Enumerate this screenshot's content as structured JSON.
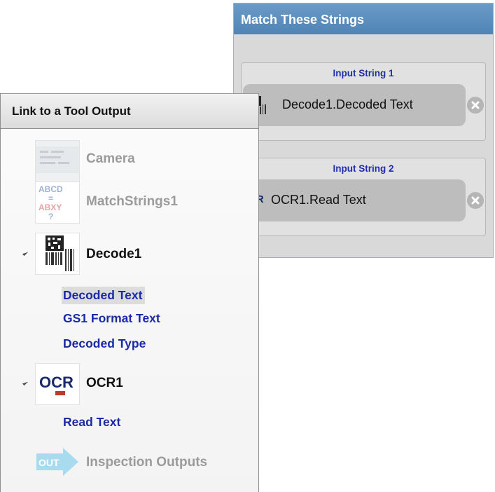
{
  "match_panel": {
    "title": "Match These Strings",
    "inputs": [
      {
        "label": "Input String 1",
        "value": "Decode1.Decoded Text",
        "icon": "barcode-icon"
      },
      {
        "label": "Input String 2",
        "value": "OCR1.Read Text",
        "icon": "ocr-icon"
      }
    ]
  },
  "link_panel": {
    "title": "Link to a Tool Output",
    "tools": [
      {
        "label": "Camera",
        "icon": "camera-image-icon",
        "enabled": false
      },
      {
        "label": "MatchStrings1",
        "icon": "match-strings-icon",
        "enabled": false
      },
      {
        "label": "Decode1",
        "icon": "barcode-icon",
        "enabled": true,
        "outputs": [
          "Decoded Text",
          "GS1 Format Text",
          "Decoded Type"
        ],
        "selected_output": "Decoded Text"
      },
      {
        "label": "OCR1",
        "icon": "ocr-icon",
        "enabled": true,
        "outputs": [
          "Read Text"
        ]
      },
      {
        "label": "Inspection Outputs",
        "icon": "out-arrow-icon",
        "enabled": false
      }
    ],
    "thumb_texts": {
      "match_top": "ABCD",
      "match_mid": "=",
      "match_bottom": "ABXY",
      "match_q": "?",
      "ocr": "OCR",
      "ocr_small": "CR",
      "out": "OUT"
    }
  },
  "colors": {
    "header_blue": "#4f84b6",
    "link_blue": "#1a2aa6",
    "disabled_gray": "#9b9b9b",
    "chip_gray": "#bdbdbd"
  }
}
